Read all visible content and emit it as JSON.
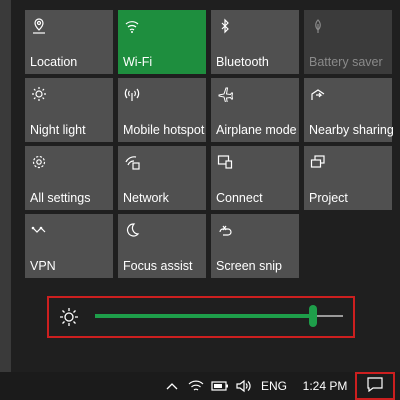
{
  "tiles": {
    "location": "Location",
    "wifi": "Wi-Fi",
    "bluetooth": "Bluetooth",
    "battery_saver": "Battery saver",
    "night_light": "Night light",
    "mobile_hotspot": "Mobile hotspot",
    "airplane_mode": "Airplane mode",
    "nearby_sharing": "Nearby sharing",
    "all_settings": "All settings",
    "network": "Network",
    "connect": "Connect",
    "project": "Project",
    "vpn": "VPN",
    "focus_assist": "Focus assist",
    "screen_snip": "Screen snip"
  },
  "tile_states": {
    "wifi": "on",
    "battery_saver": "disabled"
  },
  "brightness": {
    "level": 0.88
  },
  "taskbar": {
    "language": "ENG",
    "time": "1:24 PM"
  },
  "colors": {
    "accent": "#1e8e3e",
    "highlight_border": "#cc1f1f",
    "tile": "#505050",
    "background": "#1f1f1f"
  }
}
